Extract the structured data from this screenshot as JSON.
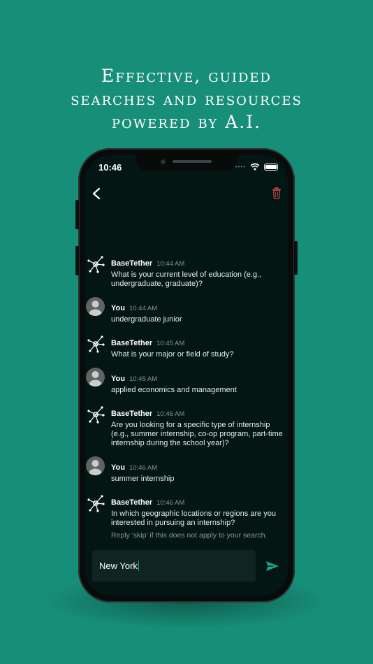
{
  "headline": {
    "line1": "Effective, guided",
    "line2": "searches and resources",
    "line3": "powered by A.I."
  },
  "status_bar": {
    "time": "10:46",
    "signal": "••••"
  },
  "header": {
    "back_icon": "chevron-left-icon",
    "delete_icon": "trash-icon"
  },
  "colors": {
    "background": "#178e78",
    "screen": "#031614",
    "accent": "#19a58b",
    "delete": "#b0413e"
  },
  "messages": [
    {
      "sender": "BaseTether",
      "time": "10:44 AM",
      "text": "What is your current level of education (e.g., undergraduate, graduate)?"
    },
    {
      "sender": "You",
      "time": "10:44 AM",
      "text": "undergraduate junior"
    },
    {
      "sender": "BaseTether",
      "time": "10:45 AM",
      "text": "What is your major or field of study?"
    },
    {
      "sender": "You",
      "time": "10:45 AM",
      "text": "applied economics and management"
    },
    {
      "sender": "BaseTether",
      "time": "10:46 AM",
      "text": "Are you looking for a specific type of internship (e.g., summer internship, co-op program, part-time internship during the school year)?"
    },
    {
      "sender": "You",
      "time": "10:46 AM",
      "text": "summer internship"
    },
    {
      "sender": "BaseTether",
      "time": "10:46 AM",
      "text": "In which geographic locations or regions are you interested in pursuing an internship?",
      "hint": "Reply 'skip' if this does not apply to your search."
    }
  ],
  "composer": {
    "value": "New York",
    "send_icon": "send-icon"
  }
}
